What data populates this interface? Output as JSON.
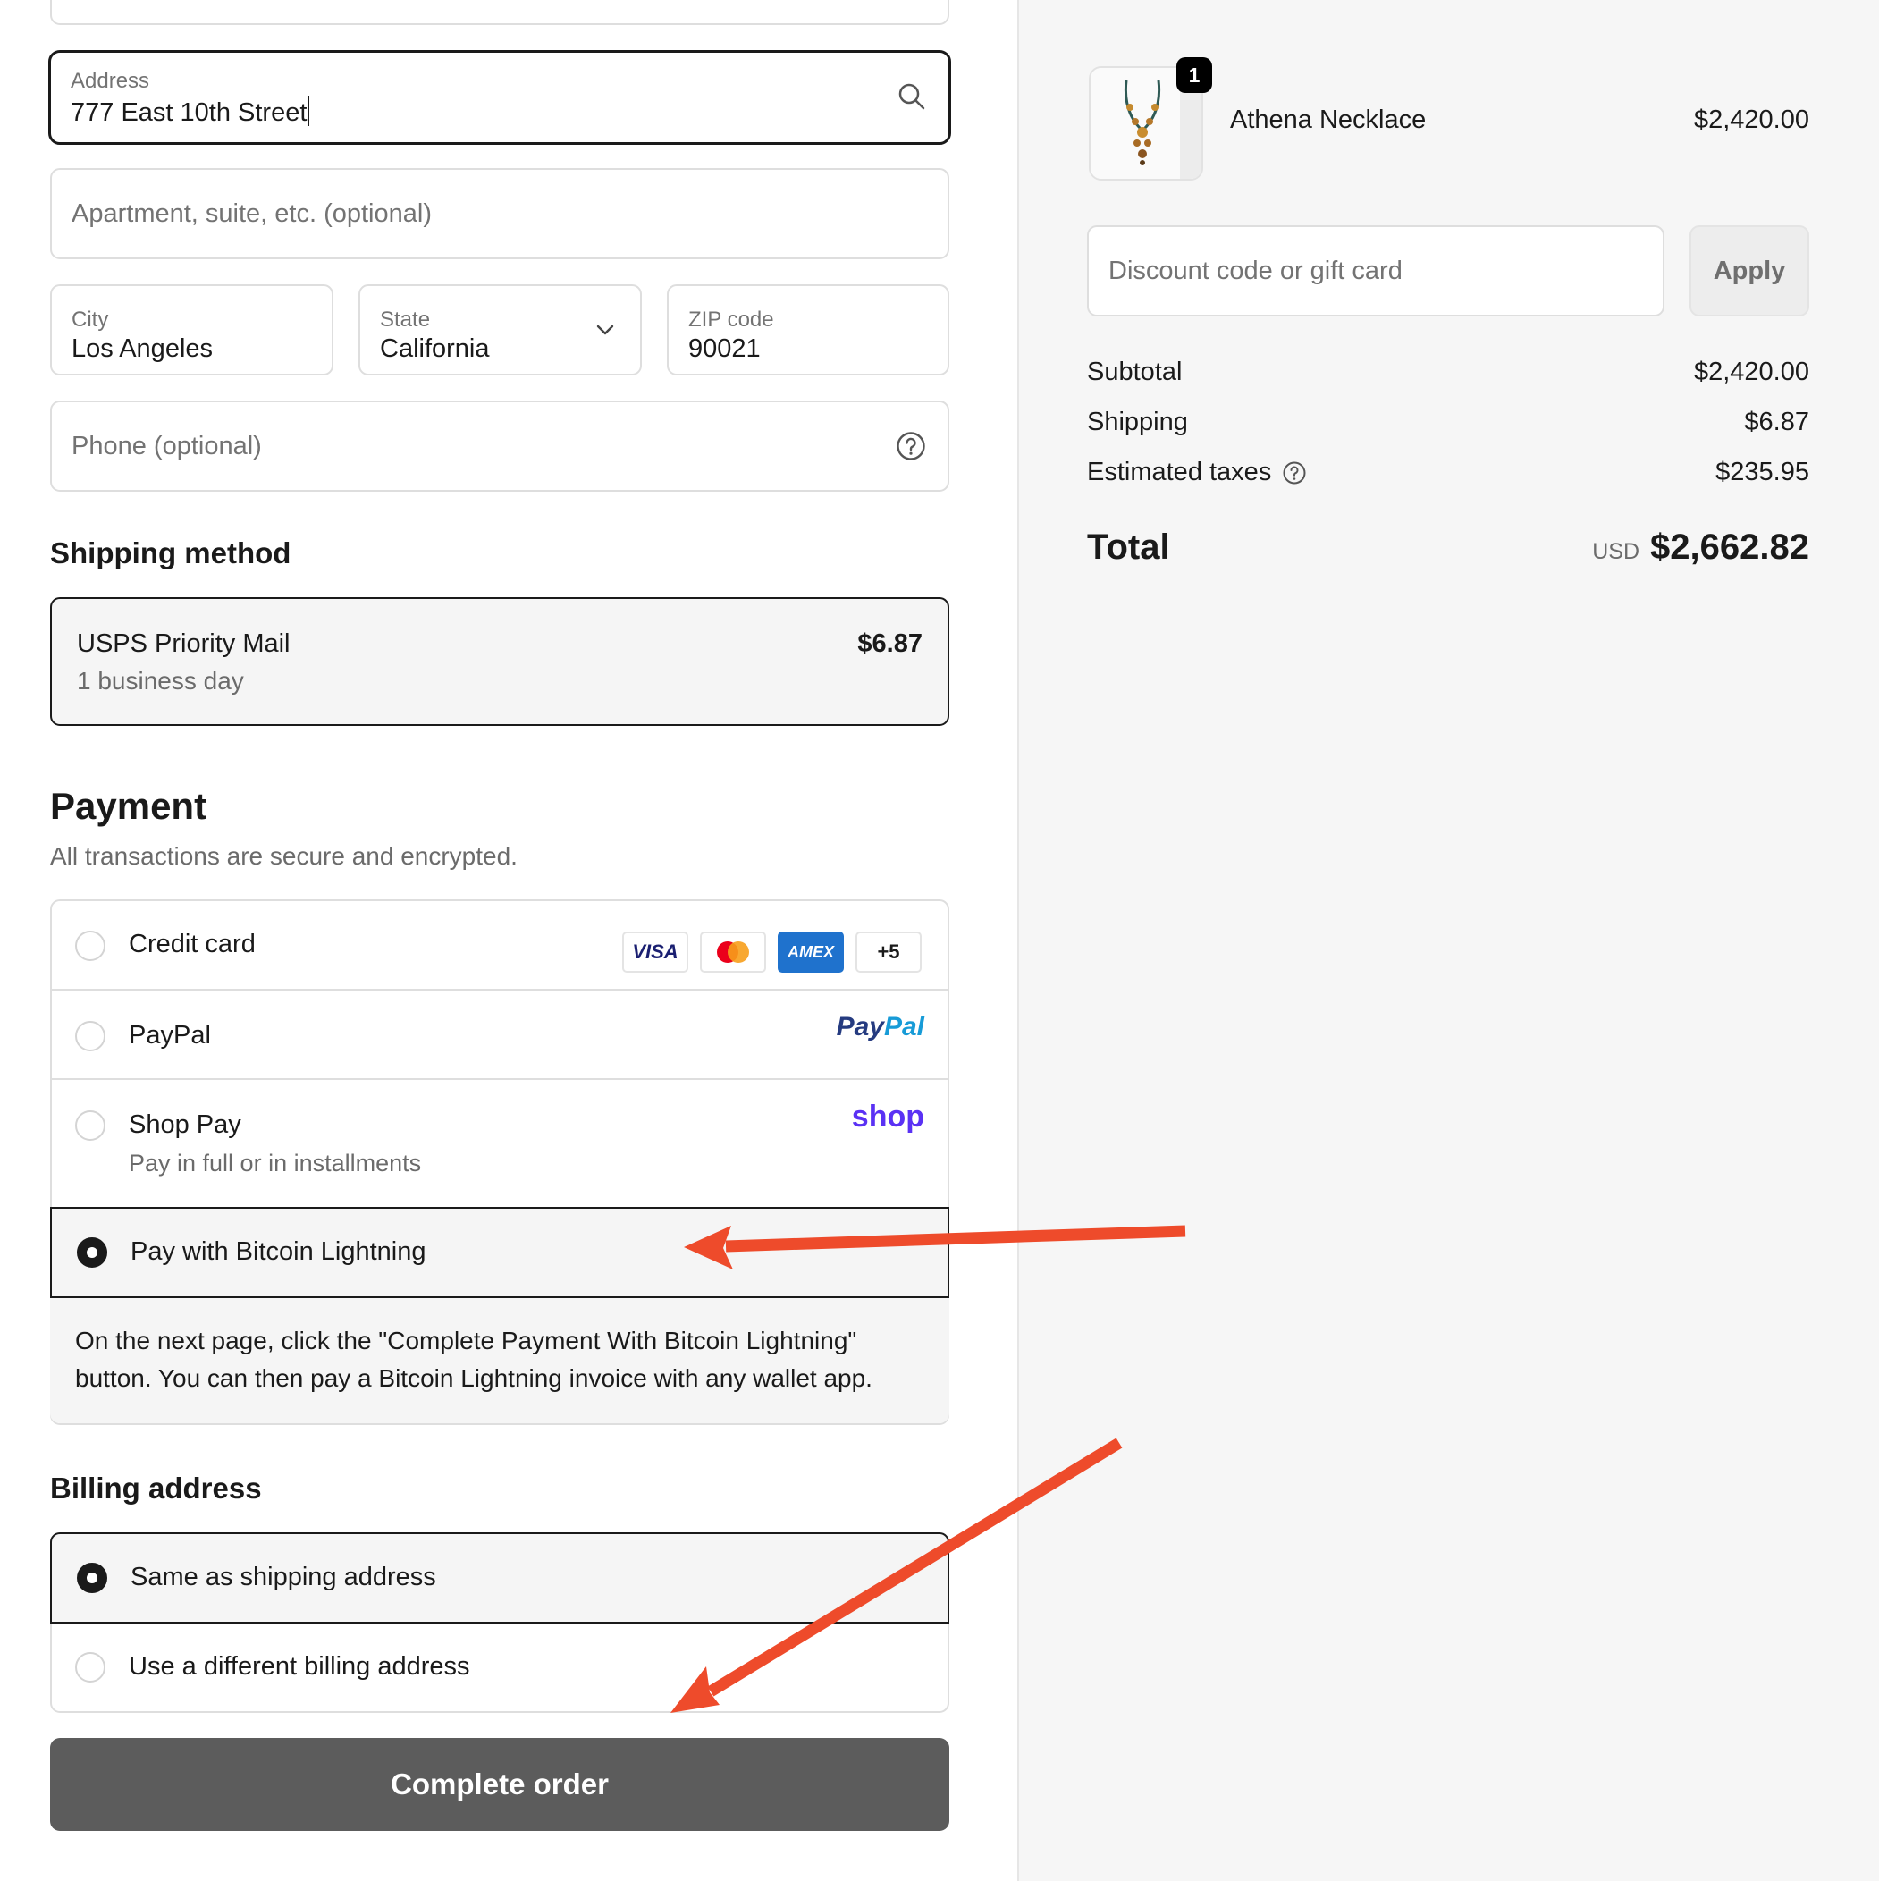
{
  "address": {
    "label": "Address",
    "value": "777 East 10th Street"
  },
  "apartment": {
    "placeholder": "Apartment, suite, etc. (optional)"
  },
  "city": {
    "label": "City",
    "value": "Los Angeles"
  },
  "state": {
    "label": "State",
    "value": "California"
  },
  "zip": {
    "label": "ZIP code",
    "value": "90021"
  },
  "phone": {
    "placeholder": "Phone (optional)"
  },
  "shipping_method": {
    "heading": "Shipping method",
    "name": "USPS Priority Mail",
    "eta": "1 business day",
    "price": "$6.87"
  },
  "payment": {
    "heading": "Payment",
    "subheading": "All transactions are secure and encrypted.",
    "credit_card": {
      "label": "Credit card",
      "icons": [
        "VISA",
        "AMEX",
        "+5"
      ]
    },
    "paypal": {
      "label": "PayPal",
      "logo_a": "Pay",
      "logo_b": "Pal"
    },
    "shop_pay": {
      "label": "Shop Pay",
      "sub": "Pay in full or in installments",
      "logo": "shop"
    },
    "bitcoin": {
      "label": "Pay with Bitcoin Lightning",
      "selected": true
    },
    "bitcoin_info_1": "On the next page, click the \"Complete Payment With Bitcoin Lightning\"",
    "bitcoin_info_2": "button. You can then pay a Bitcoin Lightning invoice with any wallet app."
  },
  "billing": {
    "heading": "Billing address",
    "same": "Same as shipping address",
    "different": "Use a different billing address"
  },
  "complete_button": "Complete order",
  "summary": {
    "item_badge": "1",
    "item_name": "Athena Necklace",
    "item_price": "$2,420.00",
    "discount_placeholder": "Discount code or gift card",
    "apply_label": "Apply",
    "subtotal_label": "Subtotal",
    "subtotal_value": "$2,420.00",
    "shipping_label": "Shipping",
    "shipping_value": "$6.87",
    "taxes_label": "Estimated taxes",
    "taxes_value": "$235.95",
    "total_label": "Total",
    "currency": "USD",
    "total_value": "$2,662.82"
  },
  "colors": {
    "accent": "#1a1a1a",
    "button_bg": "#5c5c5c",
    "annotation_arrow": "#ee4b2b",
    "shop_purple": "#5a31f4",
    "paypal_dark": "#253b80",
    "paypal_light": "#179bd7"
  }
}
